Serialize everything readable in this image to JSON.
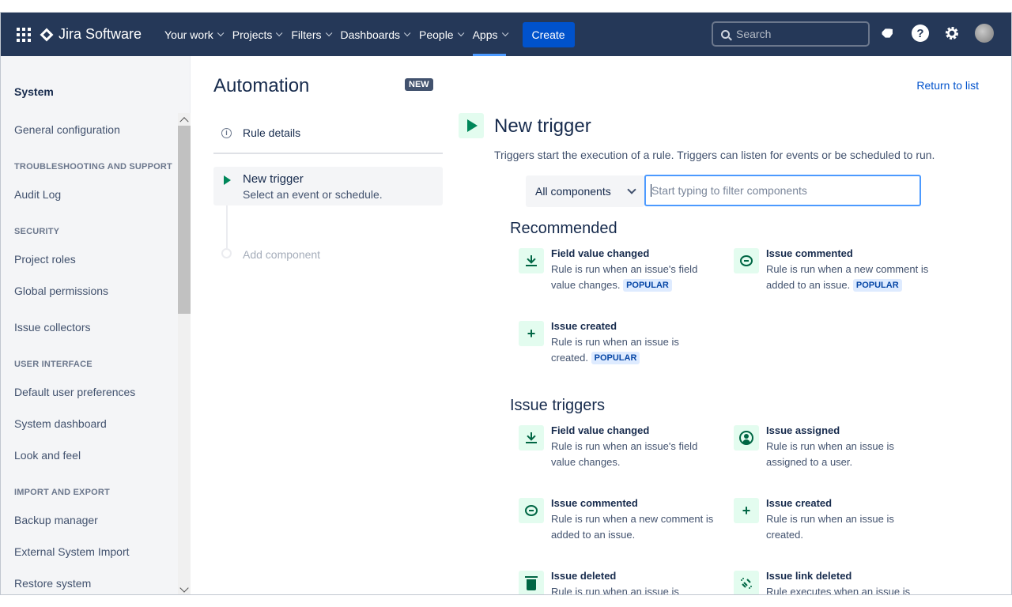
{
  "topnav": {
    "product": "Jira Software",
    "menu": [
      {
        "label": "Your work"
      },
      {
        "label": "Projects"
      },
      {
        "label": "Filters"
      },
      {
        "label": "Dashboards"
      },
      {
        "label": "People"
      },
      {
        "label": "Apps"
      }
    ],
    "create_label": "Create",
    "search_placeholder": "Search",
    "colors": {
      "background": "#253858",
      "accent": "#0052cc",
      "active_underline": "#4c9aff"
    }
  },
  "sidebar": {
    "title": "System",
    "items": [
      {
        "type": "item",
        "label": "General configuration"
      },
      {
        "type": "heading",
        "label": "TROUBLESHOOTING AND SUPPORT"
      },
      {
        "type": "item",
        "label": "Audit Log"
      },
      {
        "type": "heading",
        "label": "SECURITY"
      },
      {
        "type": "item",
        "label": "Project roles"
      },
      {
        "type": "item",
        "label": "Global permissions"
      },
      {
        "type": "item",
        "label": "Issue collectors"
      },
      {
        "type": "heading",
        "label": "USER INTERFACE"
      },
      {
        "type": "item",
        "label": "Default user preferences"
      },
      {
        "type": "item",
        "label": "System dashboard"
      },
      {
        "type": "item",
        "label": "Look and feel"
      },
      {
        "type": "heading",
        "label": "IMPORT AND EXPORT"
      },
      {
        "type": "item",
        "label": "Backup manager"
      },
      {
        "type": "item",
        "label": "External System Import"
      },
      {
        "type": "item",
        "label": "Restore system"
      }
    ]
  },
  "automation": {
    "title": "Automation",
    "badge": "NEW",
    "rule_details": "Rule details",
    "trigger_card": {
      "title": "New trigger",
      "subtitle": "Select an event or schedule."
    },
    "add_component": "Add component"
  },
  "panel": {
    "return_link": "Return to list",
    "title": "New trigger",
    "description": "Triggers start the execution of a rule. Triggers can listen for events or be scheduled to run.",
    "component_select": "All components",
    "filter_placeholder": "Start typing to filter components",
    "recommended_title": "Recommended",
    "recommended": [
      {
        "icon": "field-changed-icon",
        "title": "Field value changed",
        "desc": "Rule is run when an issue's field value changes.",
        "badge": "POPULAR"
      },
      {
        "icon": "comment-icon",
        "title": "Issue commented",
        "desc": "Rule is run when a new comment is added to an issue.",
        "badge": "POPULAR"
      },
      {
        "icon": "plus-icon",
        "title": "Issue created",
        "desc": "Rule is run when an issue is created.",
        "badge": "POPULAR"
      }
    ],
    "issue_triggers_title": "Issue triggers",
    "issue_triggers": [
      {
        "icon": "field-changed-icon",
        "title": "Field value changed",
        "desc": "Rule is run when an issue's field value changes."
      },
      {
        "icon": "user-icon",
        "title": "Issue assigned",
        "desc": "Rule is run when an issue is assigned to a user."
      },
      {
        "icon": "comment-icon",
        "title": "Issue commented",
        "desc": "Rule is run when a new comment is added to an issue."
      },
      {
        "icon": "plus-icon",
        "title": "Issue created",
        "desc": "Rule is run when an issue is created."
      },
      {
        "icon": "trash-icon",
        "title": "Issue deleted",
        "desc": "Rule is run when an issue is deleted."
      },
      {
        "icon": "link-broken-icon",
        "title": "Issue link deleted",
        "desc": "Rule executes when an issue is unlinked."
      }
    ]
  }
}
